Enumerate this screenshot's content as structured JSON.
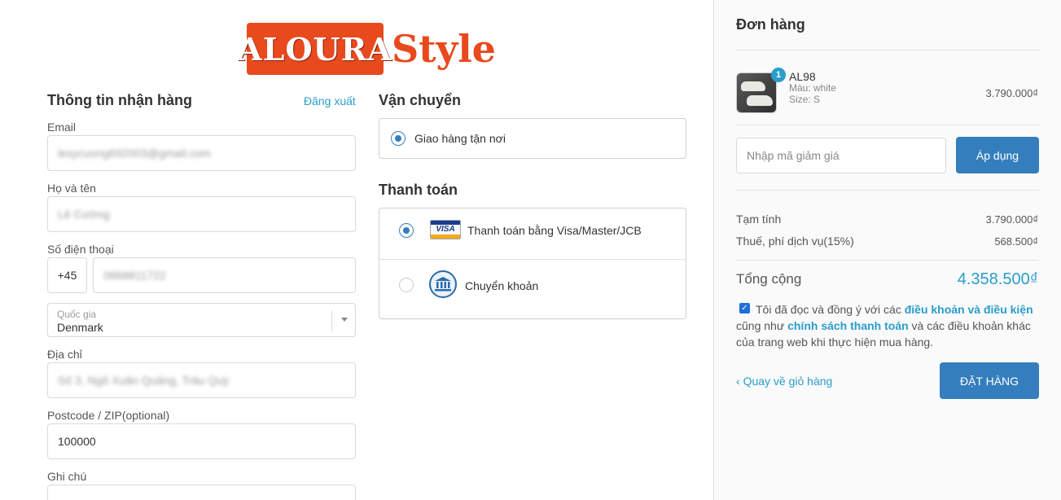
{
  "logo": {
    "box_text": "ALOURA",
    "style_text": "Style"
  },
  "shipping_info": {
    "title": "Thông tin nhận hàng",
    "logout_link": "Đăng xuất",
    "email_label": "Email",
    "email_value": "lesycuong692003@gmail.com",
    "name_label": "Họ và tên",
    "name_value": "Lê Cường",
    "phone_label": "Số điện thoại",
    "phone_code": "+45",
    "phone_value": "0868811722",
    "country_label": "Quốc gia",
    "country_value": "Denmark",
    "address_label": "Địa chỉ",
    "address_value": "Số 3, Ngõ Xuân Quảng, Trâu Quỳ",
    "postcode_label": "Postcode / ZIP(optional)",
    "postcode_value": "100000",
    "note_label": "Ghi chú"
  },
  "shipping_method": {
    "title": "Vận chuyển",
    "option_label": "Giao hàng tận nơi"
  },
  "payment": {
    "title": "Thanh toán",
    "options": [
      {
        "label": "Thanh toán bằng Visa/Master/JCB",
        "icon": "visa-card-icon",
        "icon_text": "VISA"
      },
      {
        "label": "Chuyển khoản",
        "icon": "bank-icon"
      }
    ]
  },
  "order": {
    "title": "Đơn hàng",
    "item": {
      "quantity": "1",
      "name": "AL98",
      "color": "Màu: white",
      "size": "Size: S",
      "price": "3.790.000₫"
    },
    "coupon_placeholder": "Nhập mã giảm giá",
    "apply_button": "Áp dụng",
    "subtotal_label": "Tạm tính",
    "subtotal_value": "3.790.000₫",
    "tax_label": "Thuế, phí dịch vụ(15%)",
    "tax_value": "568.500₫",
    "total_label": "Tổng cộng",
    "total_value": "4.358.500₫",
    "terms_prefix": "Tôi đã đọc và đồng ý với các ",
    "terms_link1": "điều khoản và điều kiện",
    "terms_middle": " cũng như ",
    "terms_link2": "chính sách thanh toán",
    "terms_suffix": " và các điều khoản khác của trang web khi thực hiện mua hàng.",
    "back_link": "Quay về giỏ hàng",
    "place_order_button": "ĐẶT HÀNG"
  },
  "colors": {
    "brand": "#e8491d",
    "primary": "#357ebd",
    "link": "#2a9dcc"
  }
}
